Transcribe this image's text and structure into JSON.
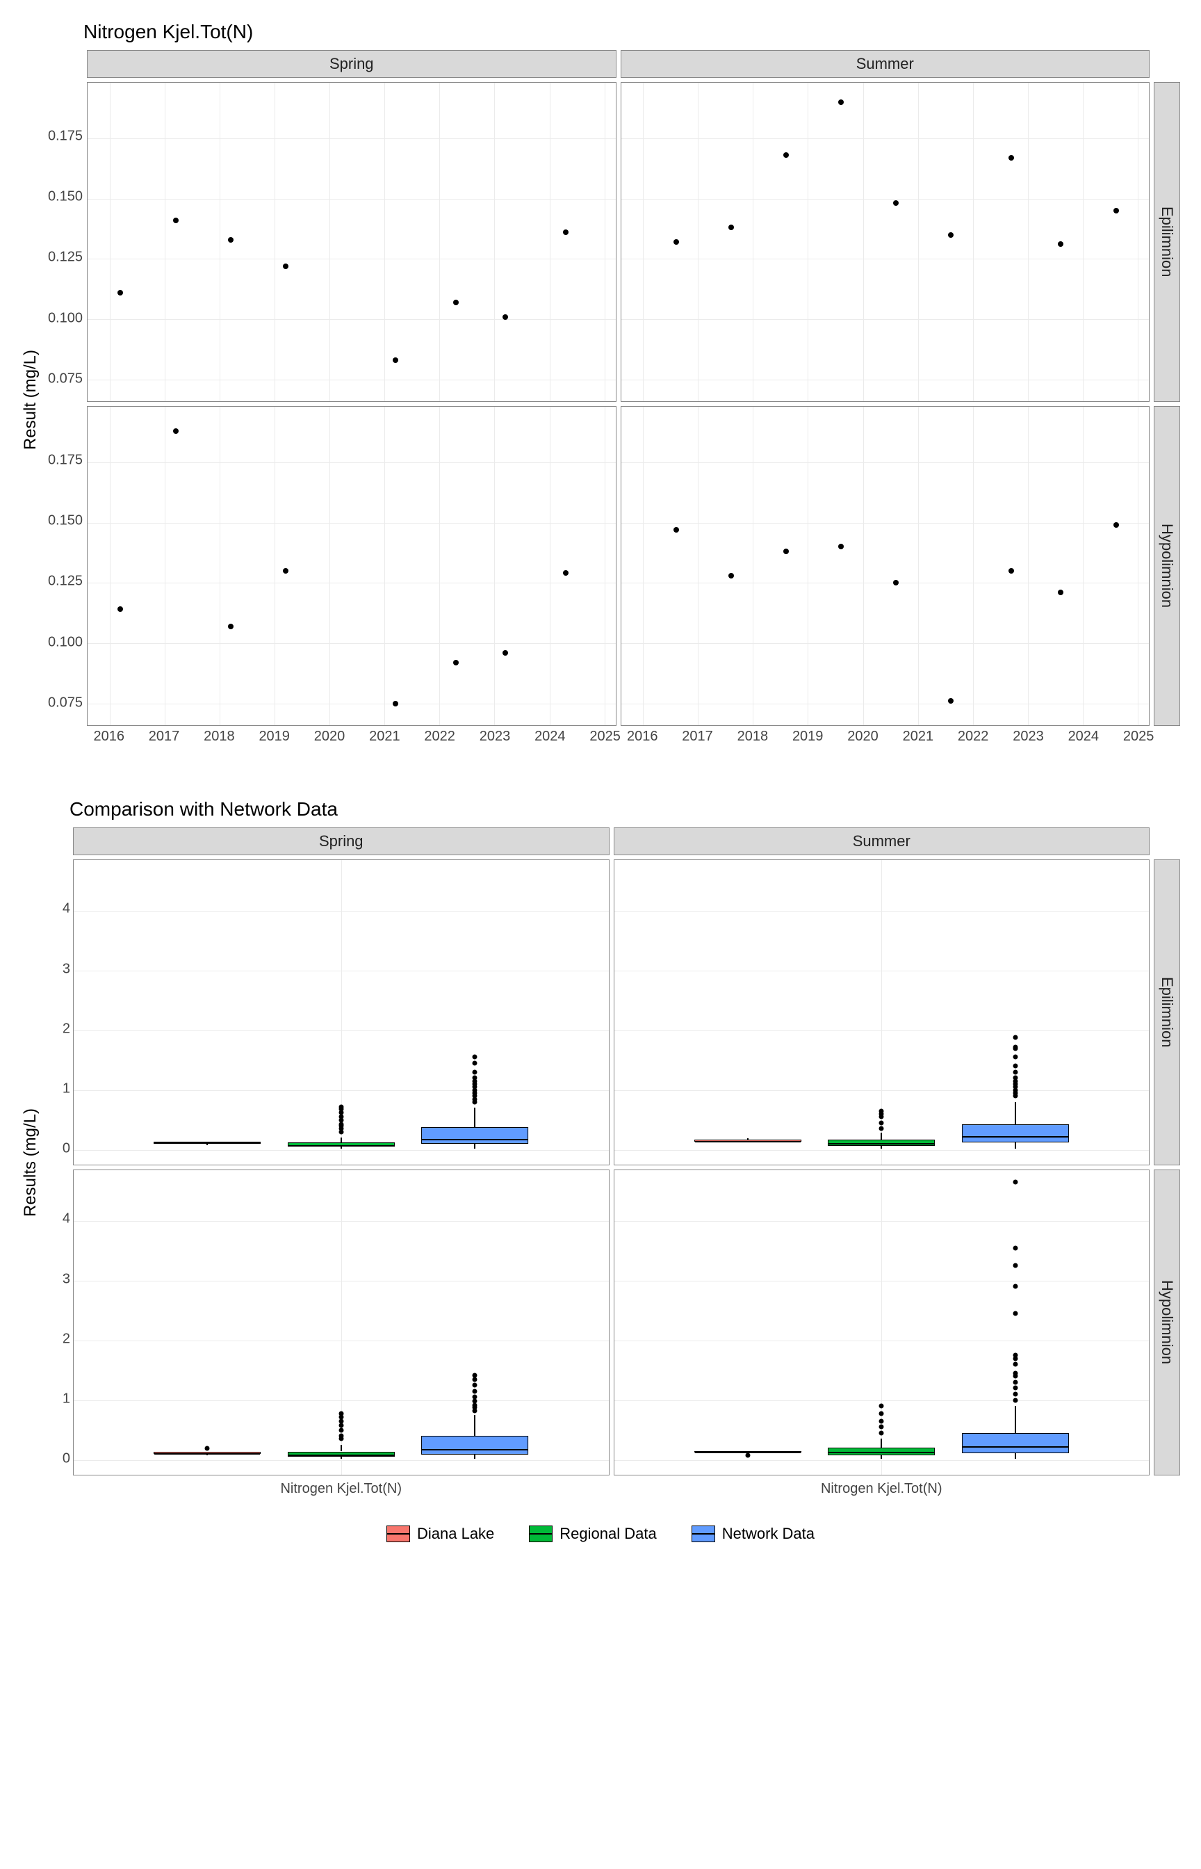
{
  "chart_data": [
    {
      "type": "scatter",
      "title": "Nitrogen Kjel.Tot(N)",
      "ylabel": "Result (mg/L)",
      "x_range": [
        2015.6,
        2025.2
      ],
      "y_range": [
        0.066,
        0.198
      ],
      "y_ticks": [
        0.075,
        0.1,
        0.125,
        0.15,
        0.175
      ],
      "x_ticks": [
        2016,
        2017,
        2018,
        2019,
        2020,
        2021,
        2022,
        2023,
        2024,
        2025
      ],
      "col_facets": [
        "Spring",
        "Summer"
      ],
      "row_facets": [
        "Epilimnion",
        "Hypolimnion"
      ],
      "panels": {
        "Spring_Epilimnion": [
          {
            "x": 2016.2,
            "y": 0.111
          },
          {
            "x": 2017.2,
            "y": 0.141
          },
          {
            "x": 2018.2,
            "y": 0.133
          },
          {
            "x": 2019.2,
            "y": 0.122
          },
          {
            "x": 2021.2,
            "y": 0.083
          },
          {
            "x": 2022.3,
            "y": 0.107
          },
          {
            "x": 2023.2,
            "y": 0.101
          },
          {
            "x": 2024.3,
            "y": 0.136
          }
        ],
        "Summer_Epilimnion": [
          {
            "x": 2016.6,
            "y": 0.132
          },
          {
            "x": 2017.6,
            "y": 0.138
          },
          {
            "x": 2018.6,
            "y": 0.168
          },
          {
            "x": 2019.6,
            "y": 0.19
          },
          {
            "x": 2020.6,
            "y": 0.148
          },
          {
            "x": 2021.6,
            "y": 0.135
          },
          {
            "x": 2022.7,
            "y": 0.167
          },
          {
            "x": 2023.6,
            "y": 0.131
          },
          {
            "x": 2024.6,
            "y": 0.145
          }
        ],
        "Spring_Hypolimnion": [
          {
            "x": 2016.2,
            "y": 0.114
          },
          {
            "x": 2017.2,
            "y": 0.188
          },
          {
            "x": 2018.2,
            "y": 0.107
          },
          {
            "x": 2019.2,
            "y": 0.13
          },
          {
            "x": 2021.2,
            "y": 0.075
          },
          {
            "x": 2022.3,
            "y": 0.092
          },
          {
            "x": 2023.2,
            "y": 0.096
          },
          {
            "x": 2024.3,
            "y": 0.129
          }
        ],
        "Summer_Hypolimnion": [
          {
            "x": 2016.6,
            "y": 0.147
          },
          {
            "x": 2017.6,
            "y": 0.128
          },
          {
            "x": 2018.6,
            "y": 0.138
          },
          {
            "x": 2019.6,
            "y": 0.14
          },
          {
            "x": 2020.6,
            "y": 0.125
          },
          {
            "x": 2021.6,
            "y": 0.076
          },
          {
            "x": 2022.7,
            "y": 0.13
          },
          {
            "x": 2023.6,
            "y": 0.121
          },
          {
            "x": 2024.6,
            "y": 0.149
          }
        ]
      }
    },
    {
      "type": "boxplot",
      "title": "Comparison with Network Data",
      "ylabel": "Results (mg/L)",
      "xlabel": "Nitrogen Kjel.Tot(N)",
      "y_range": [
        -0.25,
        4.85
      ],
      "y_ticks": [
        0,
        1,
        2,
        3,
        4
      ],
      "col_facets": [
        "Spring",
        "Summer"
      ],
      "row_facets": [
        "Epilimnion",
        "Hypolimnion"
      ],
      "groups": [
        "Diana Lake",
        "Regional Data",
        "Network Data"
      ],
      "colors": {
        "Diana Lake": "#F8766D",
        "Regional Data": "#00BA38",
        "Network Data": "#619CFF"
      },
      "panels": {
        "Spring_Epilimnion": {
          "Diana Lake": {
            "min": 0.08,
            "q1": 0.1,
            "med": 0.115,
            "q3": 0.135,
            "max": 0.14,
            "outliers": []
          },
          "Regional Data": {
            "min": 0.02,
            "q1": 0.05,
            "med": 0.08,
            "q3": 0.12,
            "max": 0.2,
            "outliers": [
              0.3,
              0.35,
              0.4,
              0.42,
              0.5,
              0.55,
              0.62,
              0.68,
              0.72
            ]
          },
          "Network Data": {
            "min": 0.02,
            "q1": 0.1,
            "med": 0.18,
            "q3": 0.38,
            "max": 0.7,
            "outliers": [
              0.8,
              0.85,
              0.9,
              0.95,
              1.0,
              1.05,
              1.1,
              1.15,
              1.2,
              1.3,
              1.45,
              1.55
            ]
          }
        },
        "Summer_Epilimnion": {
          "Diana Lake": {
            "min": 0.13,
            "q1": 0.135,
            "med": 0.145,
            "q3": 0.165,
            "max": 0.19,
            "outliers": []
          },
          "Regional Data": {
            "min": 0.02,
            "q1": 0.07,
            "med": 0.11,
            "q3": 0.17,
            "max": 0.28,
            "outliers": [
              0.35,
              0.45,
              0.55,
              0.6,
              0.65
            ]
          },
          "Network Data": {
            "min": 0.02,
            "q1": 0.12,
            "med": 0.22,
            "q3": 0.42,
            "max": 0.8,
            "outliers": [
              0.9,
              0.95,
              1.0,
              1.05,
              1.1,
              1.15,
              1.2,
              1.3,
              1.4,
              1.55,
              1.7,
              1.72,
              1.88
            ]
          }
        },
        "Spring_Hypolimnion": {
          "Diana Lake": {
            "min": 0.075,
            "q1": 0.095,
            "med": 0.11,
            "q3": 0.13,
            "max": 0.135,
            "outliers": [
              0.19
            ]
          },
          "Regional Data": {
            "min": 0.02,
            "q1": 0.05,
            "med": 0.09,
            "q3": 0.14,
            "max": 0.25,
            "outliers": [
              0.35,
              0.4,
              0.5,
              0.58,
              0.65,
              0.72,
              0.78
            ]
          },
          "Network Data": {
            "min": 0.02,
            "q1": 0.09,
            "med": 0.18,
            "q3": 0.4,
            "max": 0.75,
            "outliers": [
              0.82,
              0.88,
              0.92,
              0.98,
              1.05,
              1.15,
              1.25,
              1.35,
              1.42
            ]
          }
        },
        "Summer_Hypolimnion": {
          "Diana Lake": {
            "min": 0.12,
            "q1": 0.125,
            "med": 0.13,
            "q3": 0.145,
            "max": 0.15,
            "outliers": [
              0.076
            ]
          },
          "Regional Data": {
            "min": 0.02,
            "q1": 0.08,
            "med": 0.13,
            "q3": 0.2,
            "max": 0.35,
            "outliers": [
              0.45,
              0.55,
              0.65,
              0.78,
              0.9
            ]
          },
          "Network Data": {
            "min": 0.02,
            "q1": 0.11,
            "med": 0.22,
            "q3": 0.45,
            "max": 0.9,
            "outliers": [
              1.0,
              1.1,
              1.2,
              1.3,
              1.4,
              1.45,
              1.6,
              1.7,
              1.75,
              2.45,
              2.9,
              3.25,
              3.55,
              4.65
            ]
          }
        }
      }
    }
  ],
  "legend": {
    "items": [
      "Diana Lake",
      "Regional Data",
      "Network Data"
    ]
  }
}
